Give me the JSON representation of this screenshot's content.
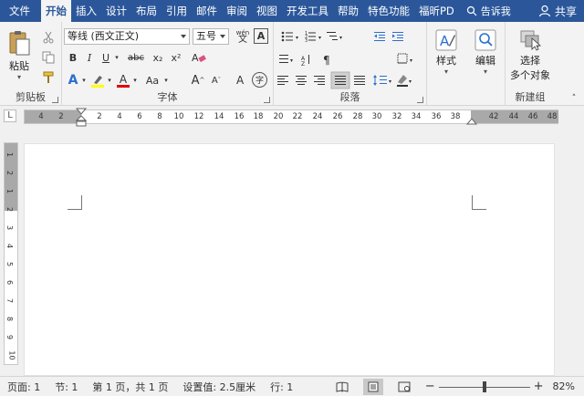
{
  "tabs": [
    "文件",
    "开始",
    "插入",
    "设计",
    "布局",
    "引用",
    "邮件",
    "审阅",
    "视图",
    "开发工具",
    "帮助",
    "特色功能",
    "福昕PD"
  ],
  "active_tab_index": 1,
  "search_label": "告诉我",
  "share_label": "共享",
  "clipboard": {
    "paste_label": "粘贴",
    "group_label": "剪贴板"
  },
  "font": {
    "font_name": "等线 (西文正文)",
    "font_size": "五号",
    "group_label": "字体",
    "bold": "B",
    "italic": "I",
    "underline": "U",
    "strike": "abc",
    "subscript": "x₂",
    "superscript": "x²",
    "grow": "A",
    "shrink": "A",
    "change_case": "Aa",
    "wen": "wén",
    "char_border": "A",
    "circle_char": "字",
    "highlight_color": "#ffff00",
    "font_color": "#e00000"
  },
  "paragraph": {
    "group_label": "段落"
  },
  "styles": {
    "label": "样式"
  },
  "editing": {
    "label": "编辑"
  },
  "new_group": {
    "select_label_1": "选择",
    "select_label_2": "多个对象",
    "group_label": "新建组"
  },
  "ruler": {
    "corner": "L",
    "ticks": [
      "4",
      "2",
      "2",
      "4",
      "6",
      "8",
      "10",
      "12",
      "14",
      "16",
      "18",
      "20",
      "22",
      "24",
      "26",
      "28",
      "30",
      "32",
      "34",
      "36",
      "38",
      "42",
      "44",
      "46",
      "48"
    ]
  },
  "vruler": {
    "ticks": [
      "1",
      "2",
      "1",
      "2",
      "3",
      "4",
      "5",
      "6",
      "7",
      "8",
      "9",
      "10"
    ]
  },
  "status": {
    "page": "页面: 1",
    "section": "节: 1",
    "page_of": "第 1 页，共 1 页",
    "position": "设置值: 2.5厘米",
    "line": "行: 1",
    "zoom_minus": "−",
    "zoom_plus": "+",
    "zoom": "82%",
    "zoom_fraction": 0.5
  }
}
